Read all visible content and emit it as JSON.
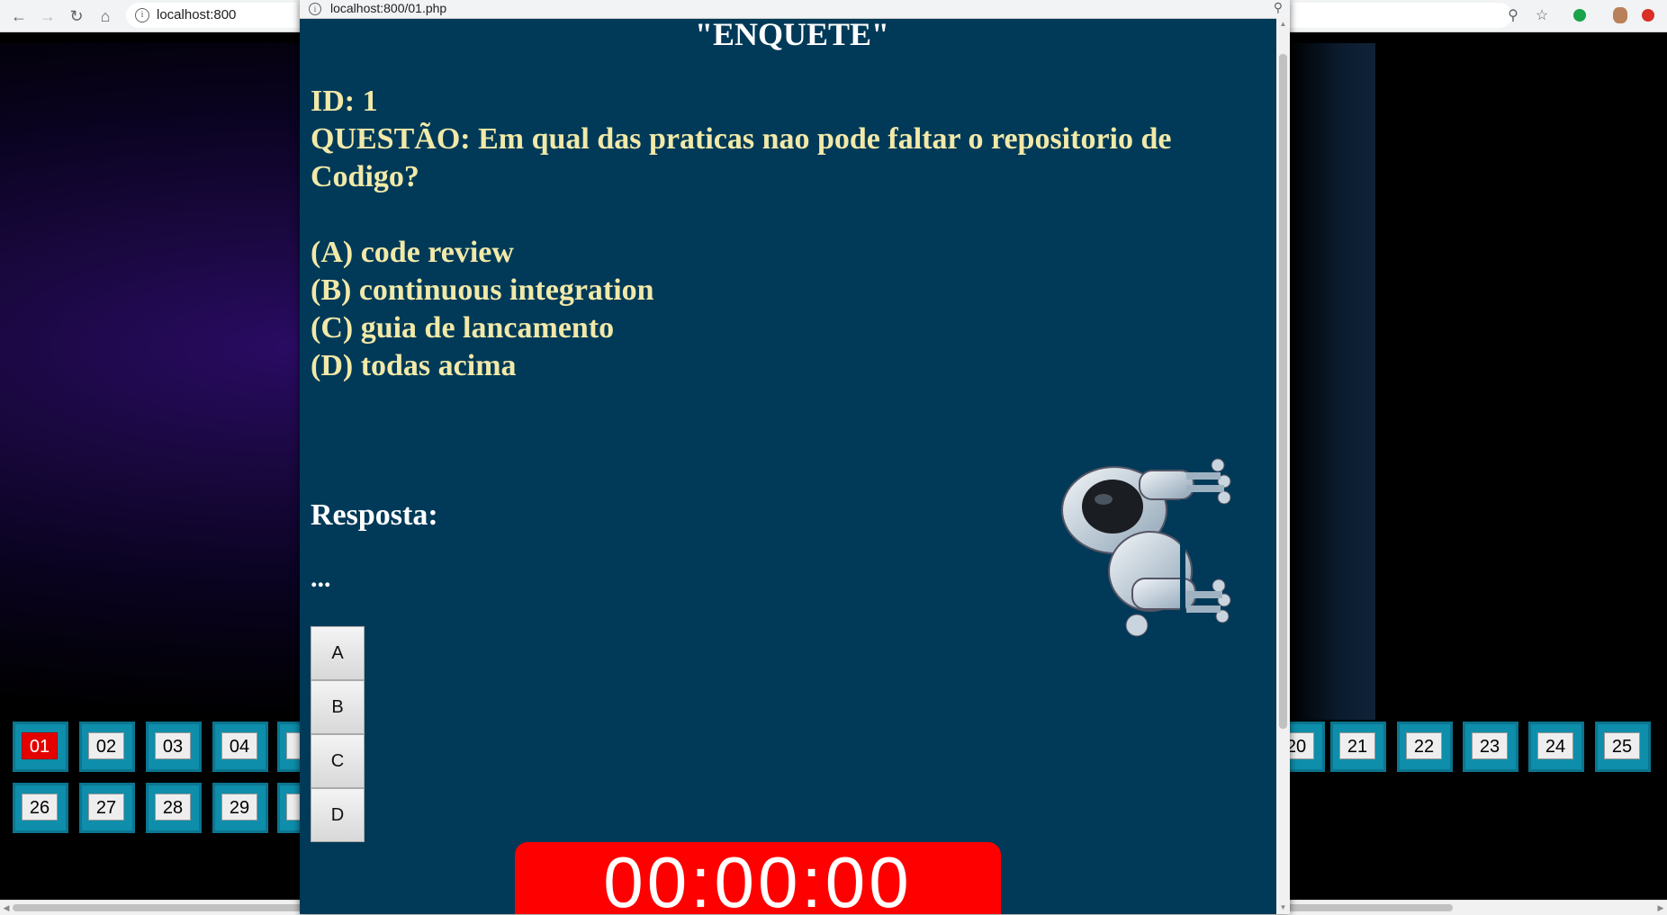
{
  "browser": {
    "url": "localhost:800",
    "popup_url": "localhost:800/01.php"
  },
  "quiz": {
    "title": "\"ENQUETE\"",
    "id_line": "ID: 1",
    "question_line": "QUESTÃO: Em qual das praticas nao pode faltar o repositorio de Codigo?",
    "options": [
      "(A) code review",
      "(B) continuous integration",
      "(C) guia de lancamento",
      "(D) todas acima"
    ],
    "answer_label": "Resposta:",
    "answer_value": "...",
    "answer_buttons": [
      "A",
      "B",
      "C",
      "D"
    ],
    "timer": "00:00:00"
  },
  "tiles": {
    "row1_left": [
      "01",
      "02",
      "03",
      "04",
      "0"
    ],
    "row1_right": [
      "20",
      "21",
      "22",
      "23",
      "24",
      "25"
    ],
    "row2_left": [
      "26",
      "27",
      "28",
      "29",
      "3"
    ]
  },
  "colors": {
    "popup_bg": "#003a58",
    "question_text": "#f2e9a8",
    "tile": "#0e8eaa",
    "active_tile": "#e50000",
    "timer_bg": "#ff0000"
  }
}
